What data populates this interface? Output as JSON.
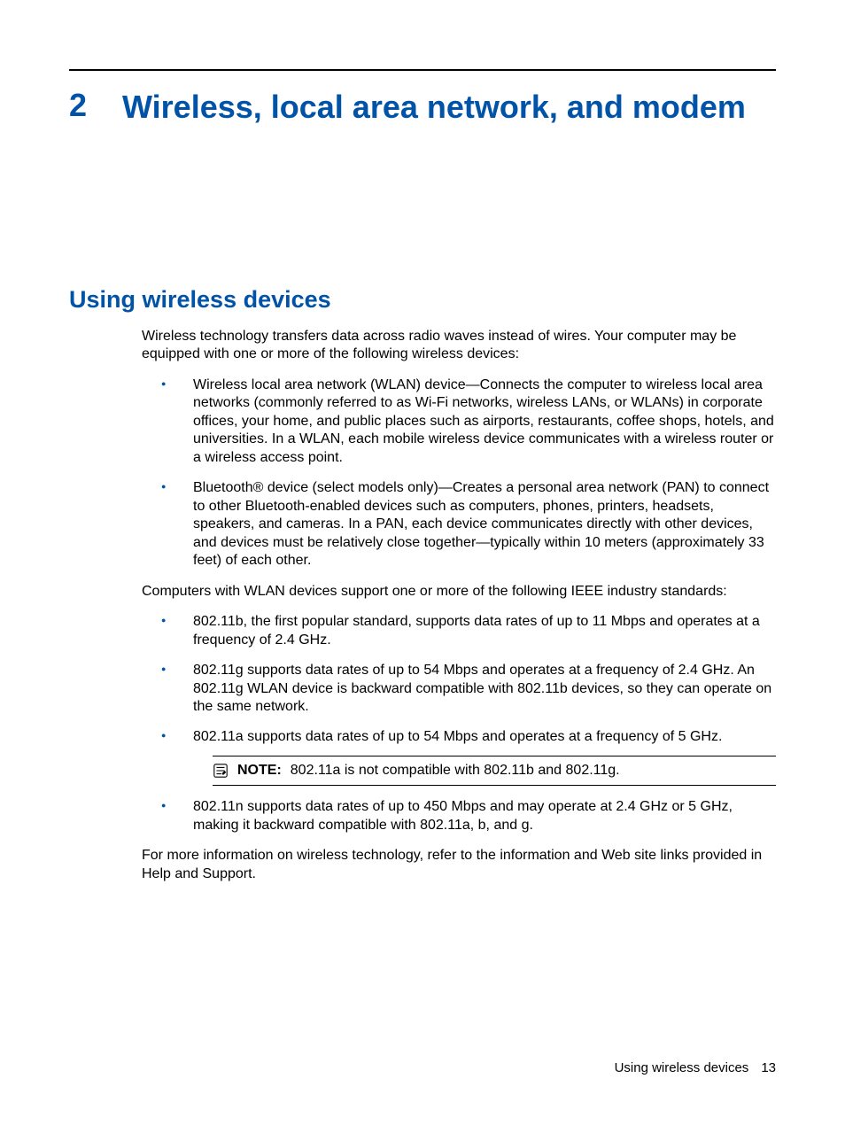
{
  "chapter": {
    "number": "2",
    "title": "Wireless, local area network, and modem"
  },
  "section": {
    "title": "Using wireless devices",
    "intro": "Wireless technology transfers data across radio waves instead of wires. Your computer may be equipped with one or more of the following wireless devices:",
    "devices": [
      "Wireless local area network (WLAN) device—Connects the computer to wireless local area networks (commonly referred to as Wi-Fi networks, wireless LANs, or WLANs) in corporate offices, your home, and public places such as airports, restaurants, coffee shops, hotels, and universities. In a WLAN, each mobile wireless device communicates with a wireless router or a wireless access point.",
      "Bluetooth® device (select models only)—Creates a personal area network (PAN) to connect to other Bluetooth-enabled devices such as computers, phones, printers, headsets, speakers, and cameras. In a PAN, each device communicates directly with other devices, and devices must be relatively close together—typically within 10 meters (approximately 33 feet) of each other."
    ],
    "standards_intro": "Computers with WLAN devices support one or more of the following IEEE industry standards:",
    "standards": [
      "802.11b, the first popular standard, supports data rates of up to 11 Mbps and operates at a frequency of 2.4 GHz.",
      "802.11g supports data rates of up to 54 Mbps and operates at a frequency of 2.4 GHz. An 802.11g WLAN device is backward compatible with 802.11b devices, so they can operate on the same network.",
      "802.11a supports data rates of up to 54 Mbps and operates at a frequency of 5 GHz."
    ],
    "note": {
      "label": "NOTE:",
      "text": "802.11a is not compatible with 802.11b and 802.11g."
    },
    "standards_after": [
      "802.11n supports data rates of up to 450 Mbps and may operate at 2.4 GHz or 5 GHz, making it backward compatible with 802.11a, b, and g."
    ],
    "outro": "For more information on wireless technology, refer to the information and Web site links provided in Help and Support."
  },
  "footer": {
    "label": "Using wireless devices",
    "page": "13"
  }
}
